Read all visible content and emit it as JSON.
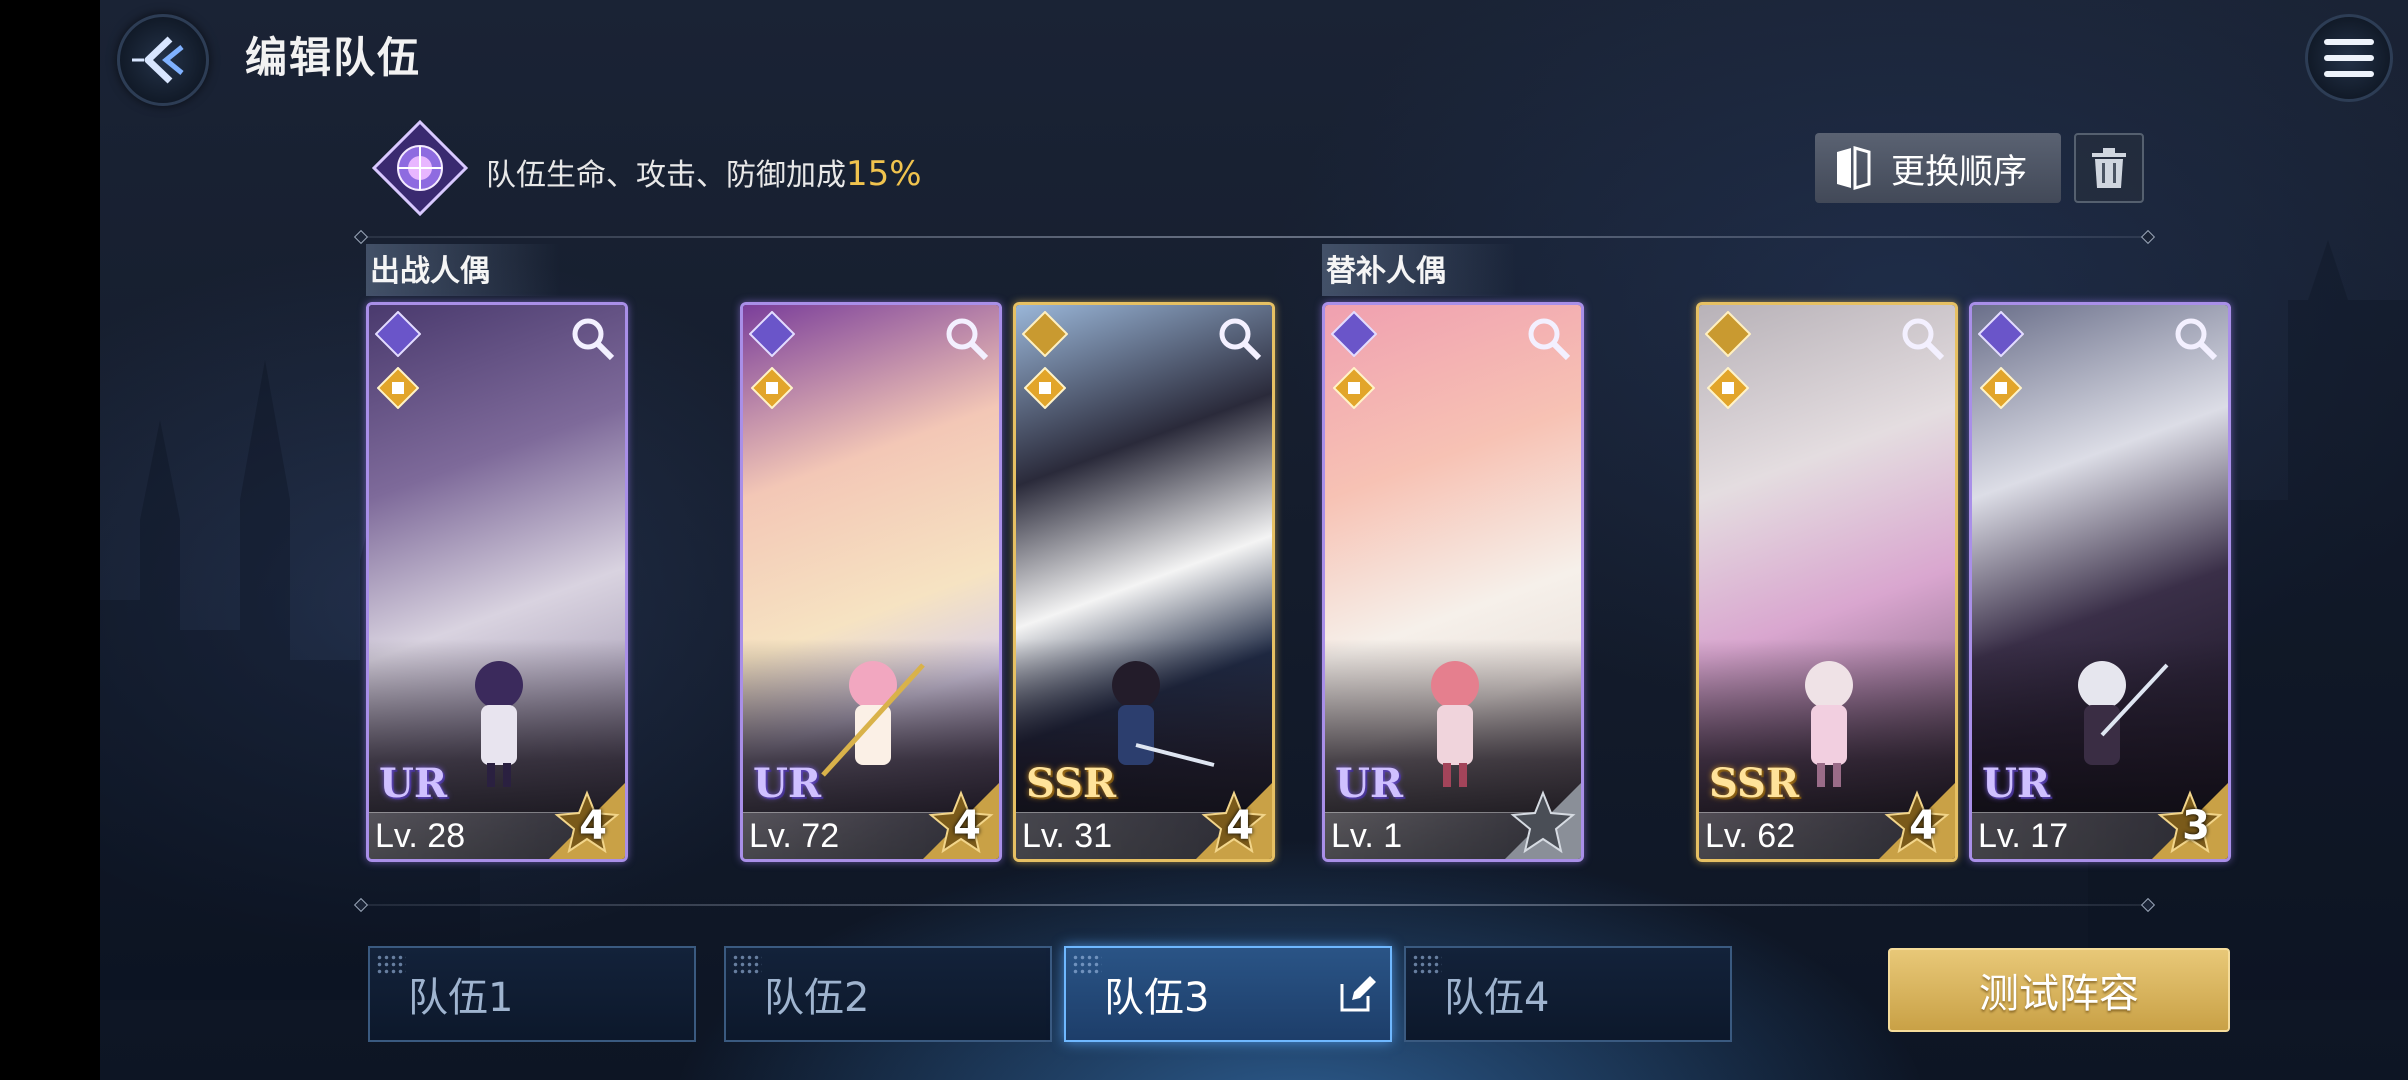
{
  "header": {
    "title": "编辑队伍",
    "back_icon": "back-arrow-icon",
    "menu_icon": "hamburger-menu-icon"
  },
  "bonus": {
    "text": "队伍生命、攻击、防御加成",
    "value": "15%"
  },
  "actions": {
    "reorder_label": "更换顺序",
    "delete_icon": "trash-icon"
  },
  "sections": {
    "main_label": "出战人偶",
    "sub_label": "替补人偶"
  },
  "main_cards": [
    {
      "rarity": "UR",
      "level": "Lv. 28",
      "stars": "4"
    },
    {
      "rarity": "UR",
      "level": "Lv. 72",
      "stars": "4"
    },
    {
      "rarity": "SSR",
      "level": "Lv. 31",
      "stars": "4"
    }
  ],
  "sub_cards": [
    {
      "rarity": "UR",
      "level": "Lv.  1",
      "stars": ""
    },
    {
      "rarity": "SSR",
      "level": "Lv. 62",
      "stars": "4"
    },
    {
      "rarity": "UR",
      "level": "Lv. 17",
      "stars": "3"
    }
  ],
  "tabs": [
    {
      "label": "队伍1"
    },
    {
      "label": "队伍2"
    },
    {
      "label": "队伍3",
      "selected": true
    },
    {
      "label": "队伍4"
    }
  ],
  "test_button": {
    "label": "测试阵容"
  }
}
